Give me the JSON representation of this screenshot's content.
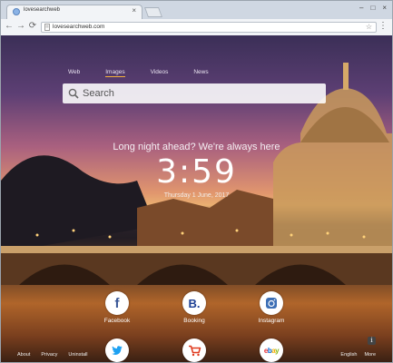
{
  "browser": {
    "tab_title": "lovesearchweb",
    "url": "lovesearchweb.com"
  },
  "nav": {
    "items": [
      "Web",
      "Images",
      "Videos",
      "News"
    ],
    "active": "Images"
  },
  "search": {
    "placeholder": "Search"
  },
  "hero": {
    "tagline": "Long night ahead? We're always here",
    "time": "3:59",
    "date": "Thursday 1 June, 2017"
  },
  "tiles": [
    {
      "label": "Facebook",
      "icon": "facebook-icon",
      "color": "#3b5998"
    },
    {
      "label": "Booking",
      "icon": "booking-icon",
      "color": "#1c3f94"
    },
    {
      "label": "Instagram",
      "icon": "instagram-icon",
      "color": "#3d6fb5"
    },
    {
      "label": "",
      "icon": "twitter-icon",
      "color": "#1da1f2"
    },
    {
      "label": "",
      "icon": "shopping-cart-icon",
      "color": "#e03a1e"
    },
    {
      "label": "",
      "icon": "ebay-icon",
      "color": "#e53238"
    }
  ],
  "footer": {
    "left": [
      "About",
      "Privacy",
      "Uninstall"
    ],
    "right": [
      "English",
      "More"
    ]
  }
}
